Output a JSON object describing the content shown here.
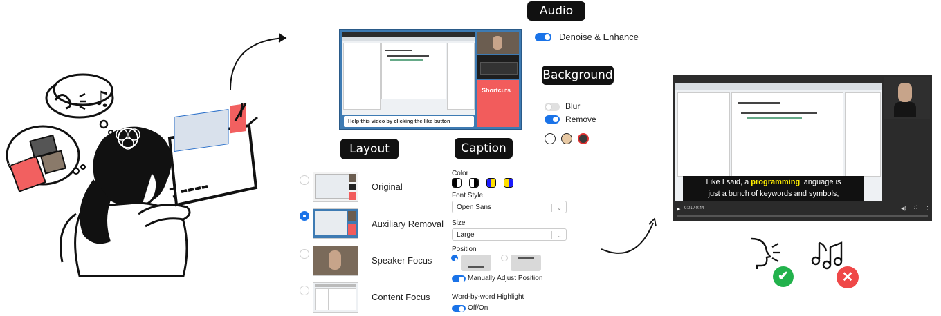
{
  "audio": {
    "title": "Audio",
    "denoise_label": "Denoise & Enhance"
  },
  "background": {
    "title": "Background",
    "blur_label": "Blur",
    "remove_label": "Remove",
    "swatches": [
      "#ffffff",
      "#e8c9a4",
      "#3a3a3a"
    ]
  },
  "preview": {
    "banner_text": "Help this video by clicking the like button",
    "shortcuts_label": "Shortcuts"
  },
  "layout": {
    "title": "Layout",
    "options": [
      {
        "label": "Original",
        "selected": false
      },
      {
        "label": "Auxiliary Removal",
        "selected": true
      },
      {
        "label": "Speaker Focus",
        "selected": false
      },
      {
        "label": "Content Focus",
        "selected": false
      }
    ]
  },
  "caption": {
    "title": "Caption",
    "color_label": "Color",
    "font_style_label": "Font Style",
    "font_style_value": "Open Sans",
    "size_label": "Size",
    "size_value": "Large",
    "position_label": "Position",
    "manual_adjust_label": "Manually Adjust Position",
    "word_highlight_label": "Word-by-word Highlight",
    "word_highlight_toggle_label": "Off/On",
    "color_options": [
      {
        "left": "#000000",
        "right": "#ffffff"
      },
      {
        "left": "#000000",
        "right": "#ffffff"
      },
      {
        "left": "#1a1aff",
        "right": "#ffe000"
      },
      {
        "left": "#ffe000",
        "right": "#1a1aff"
      }
    ]
  },
  "output": {
    "caption_line1_pre": "Like I said, a",
    "caption_highlight": "programming",
    "caption_line1_post": "language is",
    "caption_line2": "just a bunch of keywords and symbols,",
    "time": "0:01 / 0:44",
    "highlight_color": "#ffee00"
  },
  "illustration": {
    "shortcuts_label": "Shortcuts"
  }
}
